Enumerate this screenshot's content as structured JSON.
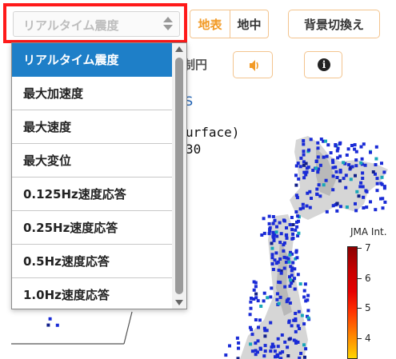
{
  "selector": {
    "current_value": "リアルタイム震度",
    "options": [
      "リアルタイム震度",
      "最大加速度",
      "最大速度",
      "最大変位",
      "0.125Hz速度応答",
      "0.25Hz速度応答",
      "0.5Hz速度応答",
      "1.0Hz速度応答"
    ],
    "selected_index": 0
  },
  "toggle": {
    "surface_label": "地表",
    "underground_label": "地中"
  },
  "background_button_label": "背景切換え",
  "circle_label_fragment": "制円",
  "sound_icon": "speaker-icon",
  "info_icon": "info-icon",
  "link_fragment": "S",
  "map_title": {
    "line1": "urface)",
    "line2": "30"
  },
  "legend": {
    "title": "JMA Int.",
    "ticks": [
      "7",
      "6",
      "5",
      "4"
    ]
  },
  "colors": {
    "highlight_border": "#ff1a1a",
    "selected_option": "#1e7fc8",
    "accent": "#f29a26",
    "station": "#1a2bd6"
  }
}
